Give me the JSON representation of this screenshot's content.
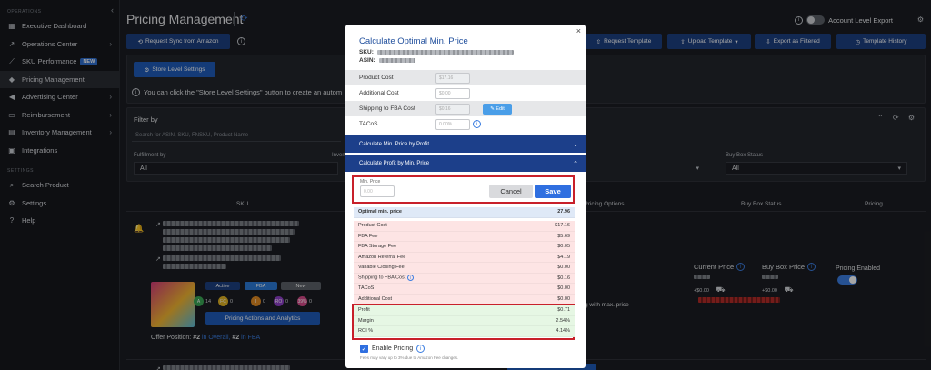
{
  "sidebar": {
    "section_ops": "OPERATIONS",
    "section_settings": "SETTINGS",
    "items": [
      {
        "label": "Executive Dashboard"
      },
      {
        "label": "Operations Center"
      },
      {
        "label": "SKU Performance",
        "badge": "NEW"
      },
      {
        "label": "Pricing Management"
      },
      {
        "label": "Advertising Center"
      },
      {
        "label": "Reimbursement"
      },
      {
        "label": "Inventory Management"
      },
      {
        "label": "Integrations"
      }
    ],
    "settings_items": [
      {
        "label": "Search Product"
      },
      {
        "label": "Settings"
      },
      {
        "label": "Help"
      }
    ]
  },
  "header": {
    "title": "Pricing Management",
    "account_toggle_label": "Account Level Export"
  },
  "toolbar": {
    "request_sync": "Request Sync from Amazon",
    "request_template": "Request Template",
    "upload_template": "Upload Template",
    "export_filtered": "Export as Filtered",
    "template_history": "Template History",
    "store_level": "Store Level Settings"
  },
  "notice": {
    "text": "You can click the \"Store Level Settings\" button to create an autom"
  },
  "filters": {
    "title": "Filter by",
    "search_placeholder": "Search for ASIN, SKU, FNSKU, Product Name",
    "fulfillment_label": "Fulfillment by",
    "fulfillment_value": "All",
    "inventory_label": "Invent",
    "buybox_label": "Buy Box Status",
    "buybox_value": "All",
    "middle_value": "All"
  },
  "table": {
    "headers": {
      "sku": "SKU",
      "pricing_options": "d Pricing Options",
      "buybox": "Buy Box Status",
      "pricing": "Pricing"
    },
    "row": {
      "status_active": "Active",
      "status_fba": "FBA",
      "status_new": "New",
      "metrics": [
        {
          "letter": "A",
          "value": "14",
          "color": "#3aa655"
        },
        {
          "letter": "FC",
          "value": "0",
          "color": "#e0b224"
        },
        {
          "letter": "I",
          "value": "0",
          "color": "#e08a24"
        },
        {
          "letter": "RO",
          "value": "0",
          "color": "#8e3fc9"
        },
        {
          "letter": "39%",
          "value": "0",
          "color": "#d64b8a"
        }
      ],
      "actions_button": "Pricing Actions and Analytics",
      "offer_position_label": "Offer Position:",
      "offer_pos_1": "#2",
      "offer_pos_1_link": "in Overall,",
      "offer_pos_2": "#2",
      "offer_pos_2_link": "in FBA",
      "max_price_text": "g with max. price",
      "current_price_label": "Current Price",
      "buybox_price_label": "Buy Box Price",
      "current_shipping": "+$0.00",
      "buybox_shipping": "+$0.00",
      "pricing_enabled_label": "Pricing Enabled"
    }
  },
  "modal": {
    "title": "Calculate Optimal Min. Price",
    "sku_label": "SKU:",
    "asin_label": "ASIN:",
    "fields": [
      {
        "label": "Product Cost",
        "placeholder": "$17.16"
      },
      {
        "label": "Additional Cost",
        "placeholder": "$0.00"
      },
      {
        "label": "Shipping to FBA Cost",
        "placeholder": "$0.16"
      },
      {
        "label": "TACoS",
        "placeholder": "0.00%"
      }
    ],
    "edit_label": "Edit",
    "accordion_profit": "Calculate Min. Price by Profit",
    "accordion_min": "Calculate Profit by Min. Price",
    "min_price_label": "Min. Price",
    "min_price_placeholder": "0.00",
    "cancel": "Cancel",
    "save": "Save",
    "optimal_label": "Optimal min. price",
    "optimal_value": "27.96",
    "costs": [
      {
        "label": "Product Cost",
        "value": "$17.16"
      },
      {
        "label": "FBA Fee",
        "value": "$5.69"
      },
      {
        "label": "FBA Storage Fee",
        "value": "$0.05"
      },
      {
        "label": "Amazon Referral Fee",
        "value": "$4.19"
      },
      {
        "label": "Variable Closing Fee",
        "value": "$0.00"
      },
      {
        "label": "Shipping to FBA Cost",
        "value": "$0.16"
      },
      {
        "label": "TACoS",
        "value": "$0.00"
      },
      {
        "label": "Additional Cost",
        "value": "$0.00"
      }
    ],
    "results": [
      {
        "label": "Profit",
        "value": "$0.71"
      },
      {
        "label": "Margin",
        "value": "2.54%"
      },
      {
        "label": "ROI %",
        "value": "4.14%"
      }
    ],
    "enable_label": "Enable Pricing",
    "fee_note": "Fees may vary up to 3% due to Amazon Fee changes."
  }
}
